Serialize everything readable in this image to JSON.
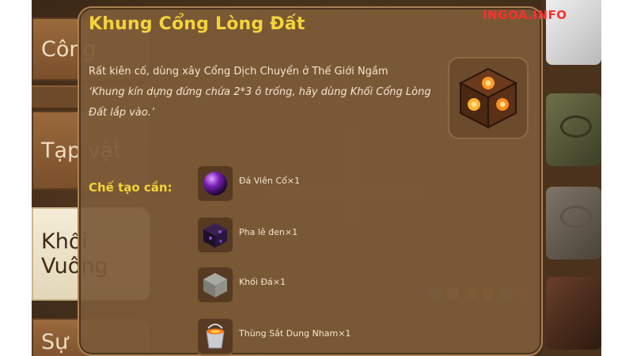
{
  "watermark": "INGOA.INFO",
  "tabs": [
    {
      "label": "Công",
      "state": "inactive"
    },
    {
      "label": "Tạp vật",
      "state": "inactive"
    },
    {
      "label": "Khối Vuông",
      "state": "active"
    },
    {
      "label": "Sự",
      "state": "inactive"
    }
  ],
  "tooltip": {
    "title": "Khung Cổng Lòng Đất",
    "description_line1": "Rất kiên cố, dùng xây Cổng Dịch Chuyển ở Thế Giới Ngầm",
    "description_line2": "‘Khung kín dựng đứng chứa 2*3 ô trống, hãy dùng Khối Cổng Lòng Đất lắp vào.’",
    "item_icon": "portal-frame-block-icon",
    "craft_label": "Chế tạo cần:",
    "ingredients": [
      {
        "name": "Đá Viên Cổ×1",
        "icon": "ancient-stone-orb-icon"
      },
      {
        "name": "Pha lê đen×1",
        "icon": "black-crystal-icon"
      },
      {
        "name": "Khối Đá×1",
        "icon": "stone-block-icon"
      },
      {
        "name": "Thùng Sắt Dung Nham×1",
        "icon": "iron-lava-bucket-icon"
      }
    ]
  },
  "colors": {
    "title": "#f4d33a",
    "craft_label": "#f4d33a",
    "panel_bg": "#7c5a38",
    "watermark": "#ff2f2f"
  }
}
